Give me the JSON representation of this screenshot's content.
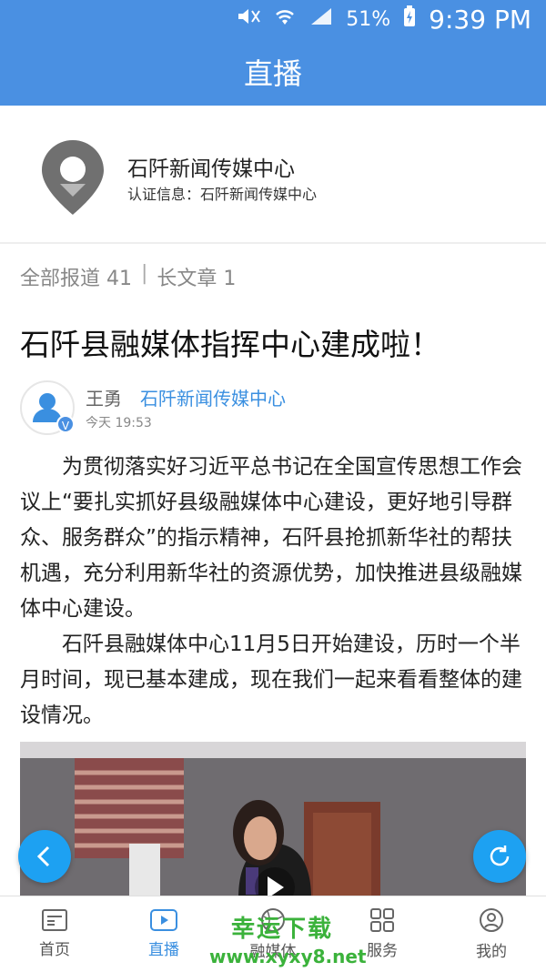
{
  "status": {
    "battery": "51%",
    "time": "9:39 PM"
  },
  "header": {
    "title": "直播"
  },
  "profile": {
    "name": "石阡新闻传媒中心",
    "cert": "认证信息：石阡新闻传媒中心"
  },
  "counts": {
    "all": "全部报道 41",
    "sep": "|",
    "long": "长文章 1"
  },
  "article": {
    "title": "石阡县融媒体指挥中心建成啦！",
    "author": "王勇",
    "org": "石阡新闻传媒中心",
    "time": "今天 19:53",
    "p1": "为贯彻落实好习近平总书记在全国宣传思想工作会议上“要扎实抓好县级融媒体中心建设，更好地引导群众、服务群众”的指示精神，石阡县抢抓新华社的帮扶机遇，充分利用新华社的资源优势，加快推进县级融媒体中心建设。",
    "p2": "石阡县融媒体中心11月5日开始建设，历时一个半月时间，现已基本建成，现在我们一起来看看整体的建设情况。"
  },
  "tabs": [
    {
      "label": "首页",
      "icon": "news-icon"
    },
    {
      "label": "直播",
      "icon": "play-icon"
    },
    {
      "label": "融媒体",
      "icon": "globe-icon"
    },
    {
      "label": "服务",
      "icon": "grid-icon"
    },
    {
      "label": "我的",
      "icon": "user-icon"
    }
  ],
  "watermark": {
    "line1": "幸运下载",
    "line2": "www.xyxy8.net"
  },
  "colors": {
    "primary": "#4a90e2",
    "accent": "#1da1f2",
    "link": "#3a8fe0"
  }
}
